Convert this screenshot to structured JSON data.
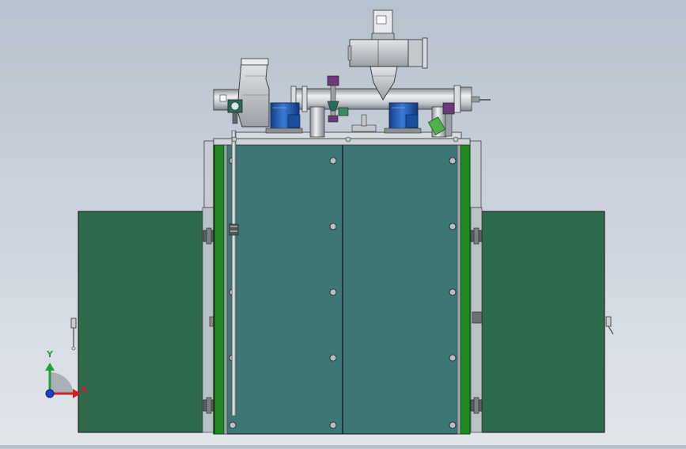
{
  "viewport": {
    "triad": {
      "x_label": "X",
      "y_label": "Y",
      "x_color": "#d02020",
      "y_color": "#22a035",
      "z_color": "#2040c8"
    }
  },
  "colors": {
    "background_top": "#b7c1cd",
    "background_bottom": "#e2e6eb",
    "main_panel": "#3e7575",
    "side_door": "#2e6a4c",
    "green_frame": "#1f8a22",
    "motor_blue": "#1f5fb8",
    "pipe_steel": "#c9ccd0",
    "valve_purple": "#6a3a7a"
  }
}
